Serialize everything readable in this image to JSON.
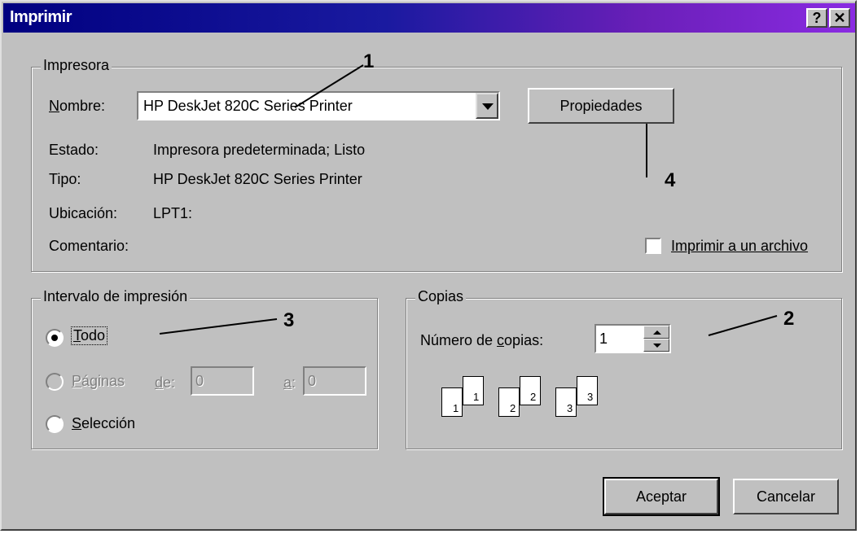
{
  "window": {
    "title": "Imprimir",
    "help_glyph": "?",
    "close_glyph": "✕"
  },
  "printer": {
    "group_label": "Impresora",
    "name_label": "Nombre:",
    "name_value": "HP DeskJet 820C Series Printer",
    "properties_label": "Propiedades",
    "status_label": "Estado:",
    "status_value": "Impresora predeterminada; Listo",
    "type_label": "Tipo:",
    "type_value": "HP DeskJet 820C Series Printer",
    "location_label": "Ubicación:",
    "location_value": "LPT1:",
    "comment_label": "Comentario:",
    "print_to_file_label": "Imprimir a un archivo",
    "print_to_file_checked": false
  },
  "range": {
    "group_label": "Intervalo de impresión",
    "all_label": "Todo",
    "pages_label": "Páginas",
    "from_label": "de:",
    "from_value": "0",
    "to_label": "a:",
    "to_value": "0",
    "selection_label": "Selección",
    "selected": "all"
  },
  "copies": {
    "group_label": "Copias",
    "count_label": "Número de copias:",
    "count_value": "1",
    "collate_pages": [
      "1",
      "1",
      "2",
      "2",
      "3",
      "3"
    ]
  },
  "buttons": {
    "ok_label": "Aceptar",
    "cancel_label": "Cancelar"
  },
  "annotations": [
    "1",
    "2",
    "3",
    "4"
  ]
}
